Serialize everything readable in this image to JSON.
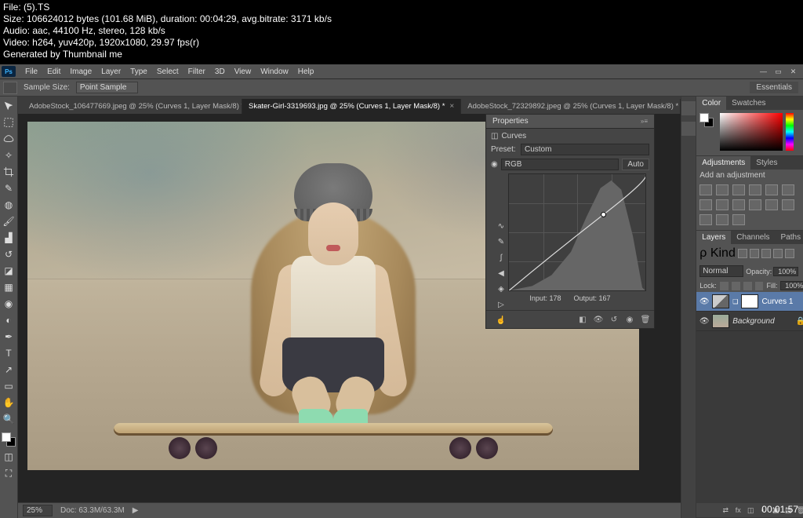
{
  "overlay": {
    "line1": "File:  (5).TS",
    "line2": "Size: 106624012 bytes (101.68 MiB), duration: 00:04:29, avg.bitrate: 3171 kb/s",
    "line3": "Audio: aac, 44100 Hz, stereo, 128 kb/s",
    "line4": "Video: h264, yuv420p, 1920x1080, 29.97 fps(r)",
    "line5": "Generated by Thumbnail me"
  },
  "timecode": "00:01:57",
  "menubar": [
    "File",
    "Edit",
    "Image",
    "Layer",
    "Type",
    "Select",
    "Filter",
    "3D",
    "View",
    "Window",
    "Help"
  ],
  "options_bar": {
    "sample_size_label": "Sample Size:",
    "sample_size_value": "Point Sample"
  },
  "workspace": "Essentials",
  "tabs": [
    {
      "label": "AdobeStock_106477669.jpeg @ 25% (Curves 1, Layer Mask/8) *",
      "active": false
    },
    {
      "label": "Skater-Girl-3319693.jpg @ 25% (Curves 1, Layer Mask/8) *",
      "active": true
    },
    {
      "label": "AdobeStock_72329892.jpeg @ 25% (Curves 1, Layer Mask/8) *",
      "active": false
    }
  ],
  "properties": {
    "title": "Properties",
    "adjustment_type": "Curves",
    "preset_label": "Preset:",
    "preset_value": "Custom",
    "channel_value": "RGB",
    "auto_label": "Auto",
    "input_label": "Input:",
    "input_value": "178",
    "output_label": "Output:",
    "output_value": "167"
  },
  "status": {
    "zoom": "25%",
    "doc": "Doc: 63.3M/63.3M"
  },
  "panels": {
    "color_tab": "Color",
    "swatches_tab": "Swatches",
    "adjustments_tab": "Adjustments",
    "styles_tab": "Styles",
    "add_adjustment": "Add an adjustment",
    "layers_tab": "Layers",
    "channels_tab": "Channels",
    "paths_tab": "Paths",
    "kind_label": "ρ Kind",
    "blend_mode": "Normal",
    "opacity_label": "Opacity:",
    "opacity_value": "100%",
    "lock_label": "Lock:",
    "fill_label": "Fill:",
    "fill_value": "100%",
    "layer_curves": "Curves 1",
    "layer_bg": "Background"
  },
  "chart_data": {
    "type": "line",
    "title": "Curves",
    "xlabel": "Input",
    "ylabel": "Output",
    "xlim": [
      0,
      255
    ],
    "ylim": [
      0,
      255
    ],
    "series": [
      {
        "name": "RGB curve",
        "x": [
          0,
          64,
          128,
          178,
          255
        ],
        "y": [
          0,
          58,
          120,
          167,
          255
        ]
      }
    ],
    "histogram": {
      "x_bins": [
        0,
        32,
        64,
        96,
        128,
        160,
        192,
        224,
        255
      ],
      "heights": [
        2,
        6,
        18,
        40,
        90,
        130,
        150,
        110,
        8
      ]
    },
    "readout": {
      "input": 178,
      "output": 167
    }
  }
}
